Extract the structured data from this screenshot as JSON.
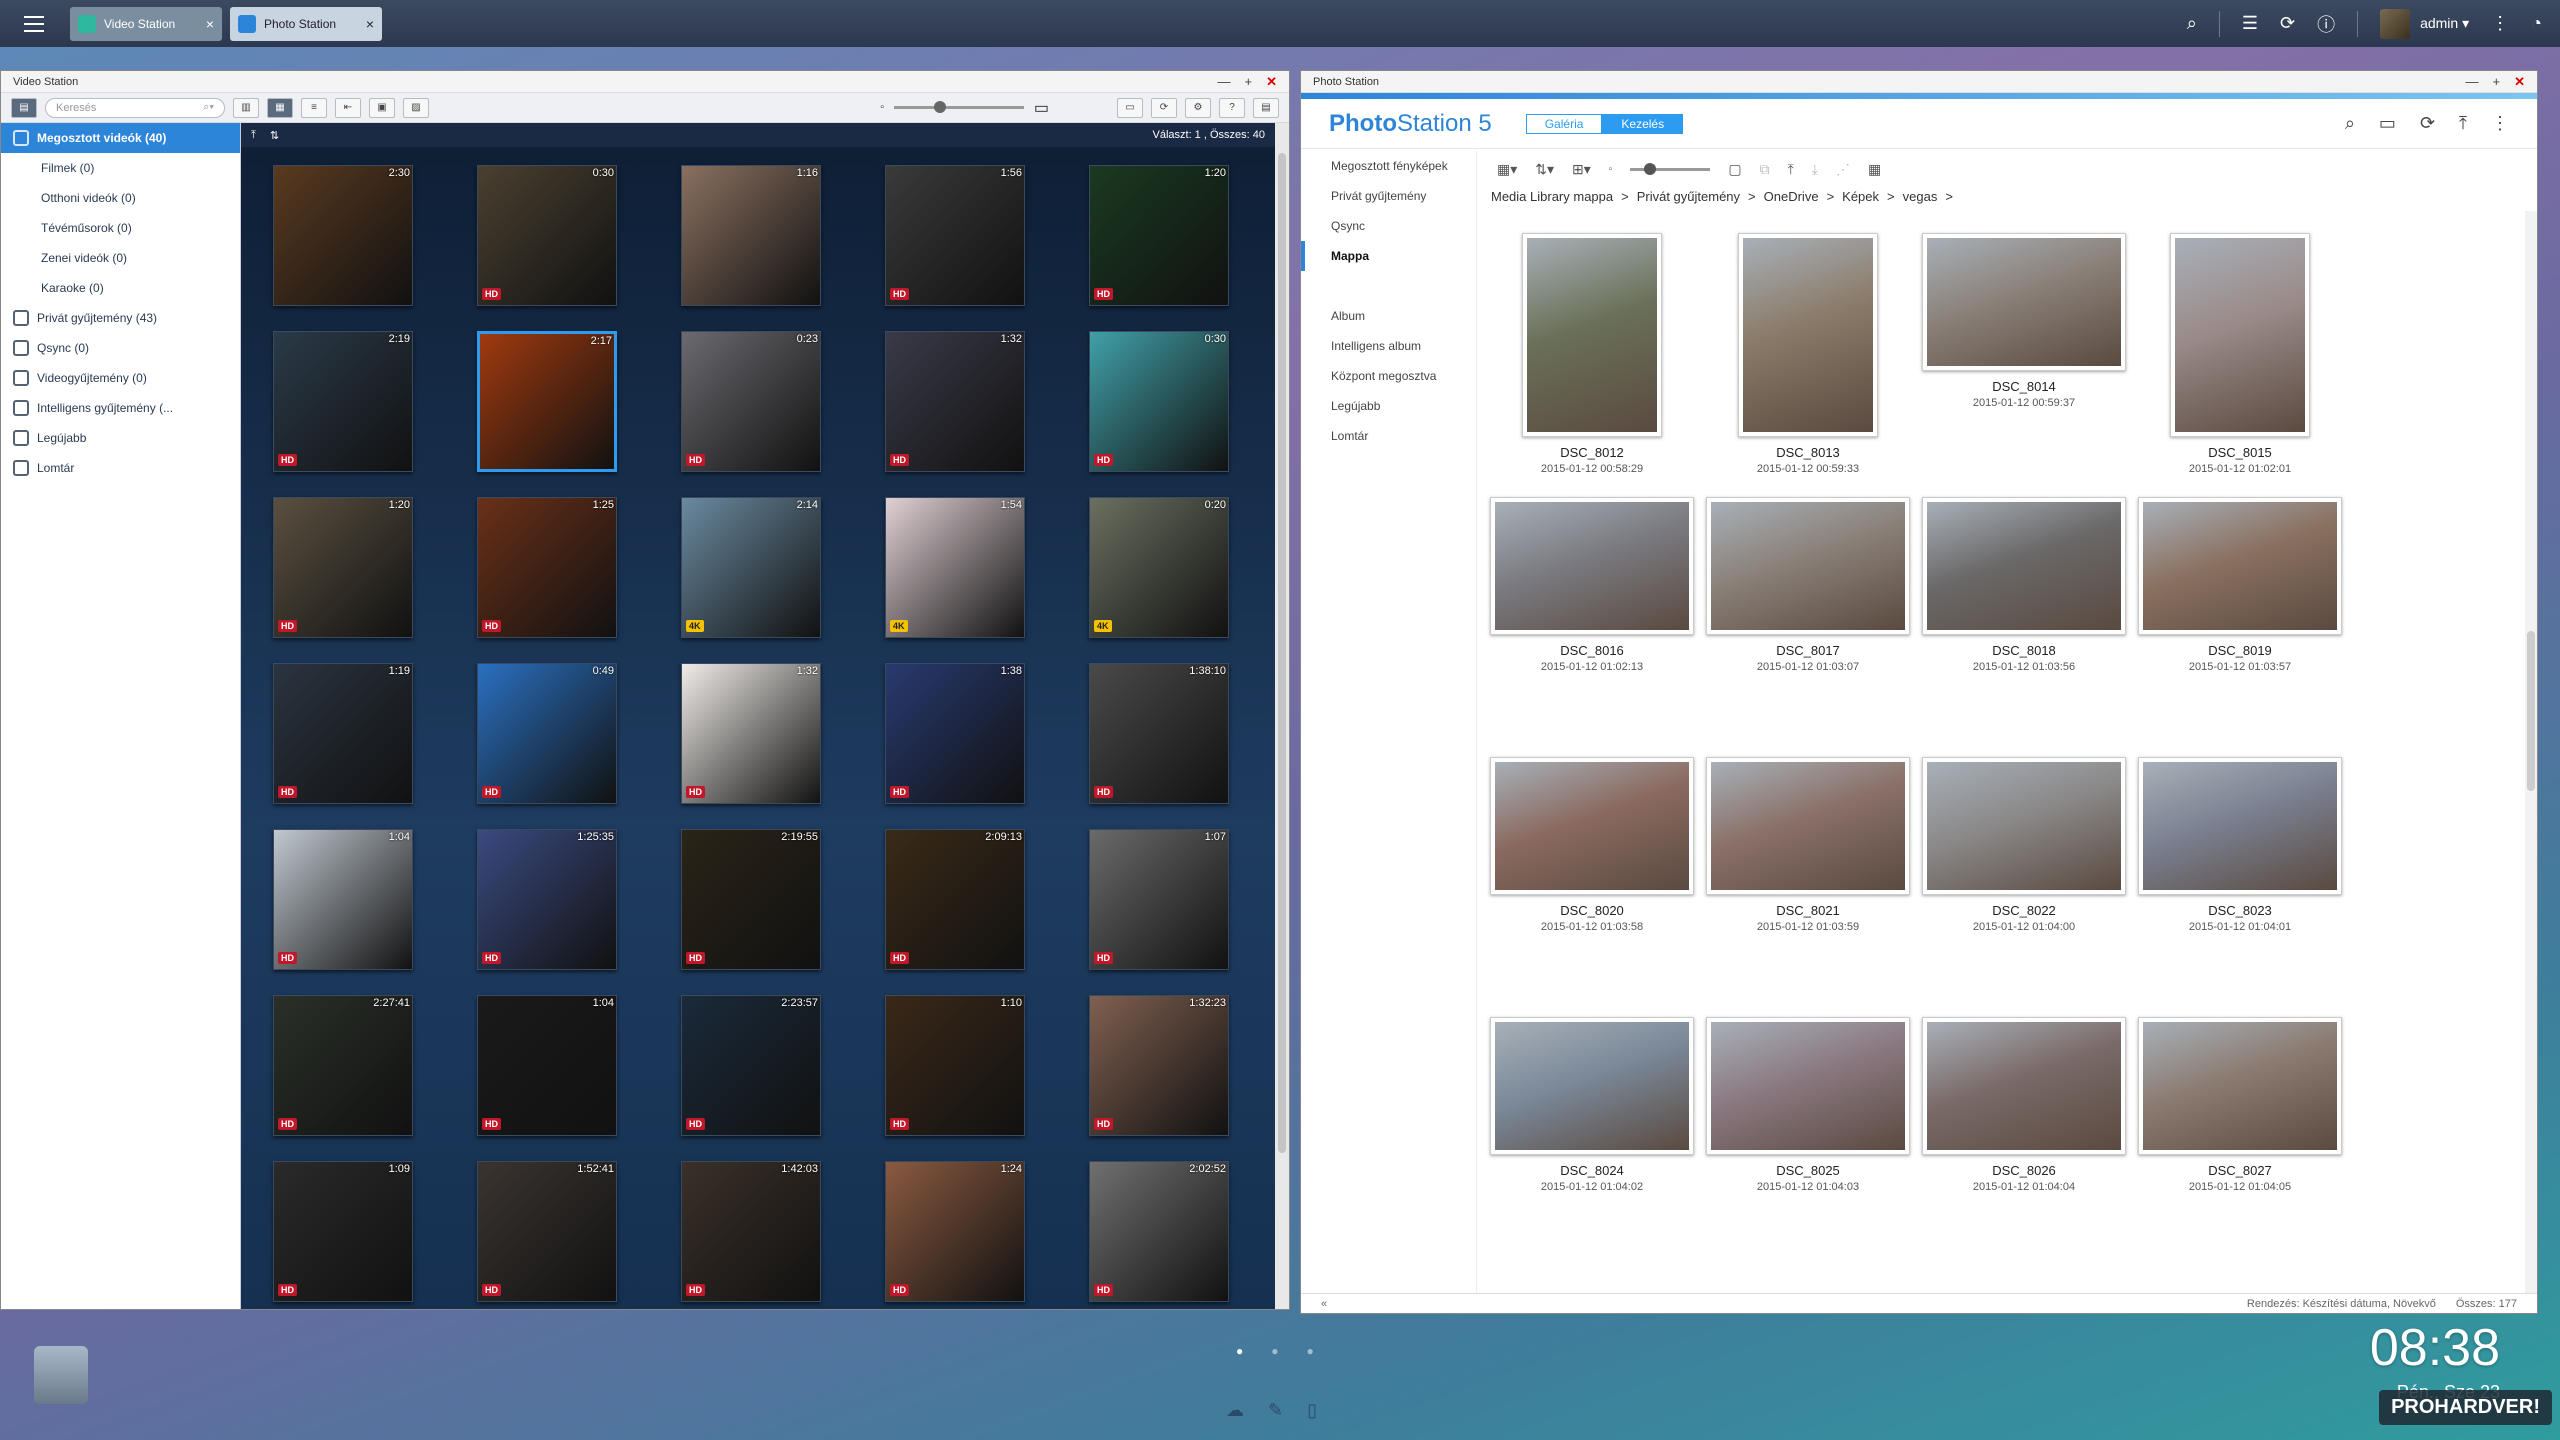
{
  "taskbar": {
    "tabs": [
      {
        "label": "Video Station"
      },
      {
        "label": "Photo Station"
      }
    ],
    "user": "admin"
  },
  "video_station": {
    "title": "Video Station",
    "search_placeholder": "Keresés",
    "selection_info": "Választ: 1 , Összes: 40",
    "sidebar": [
      {
        "label": "Megosztott videók (40)"
      },
      {
        "label": "Filmek (0)"
      },
      {
        "label": "Otthoni videók (0)"
      },
      {
        "label": "Tévéműsorok (0)"
      },
      {
        "label": "Zenei videók (0)"
      },
      {
        "label": "Karaoke (0)"
      },
      {
        "label": "Privát gyűjtemény (43)"
      },
      {
        "label": "Qsync (0)"
      },
      {
        "label": "Videogyűjtemény (0)"
      },
      {
        "label": "Intelligens gyűjtemény (..."
      },
      {
        "label": "Legújabb"
      },
      {
        "label": "Lomtár"
      }
    ],
    "videos": [
      {
        "duration": "2:30",
        "badge": "",
        "color": "#5a3a20"
      },
      {
        "duration": "0:30",
        "badge": "HD",
        "color": "#4a4030"
      },
      {
        "duration": "1:16",
        "badge": "",
        "color": "#8a7060"
      },
      {
        "duration": "1:56",
        "badge": "HD",
        "color": "#3a3a3a"
      },
      {
        "duration": "1:20",
        "badge": "HD",
        "color": "#1a3a20"
      },
      {
        "duration": "2:19",
        "badge": "HD",
        "color": "#2a3a48"
      },
      {
        "duration": "2:17",
        "badge": "",
        "color": "#a03a10"
      },
      {
        "duration": "0:23",
        "badge": "HD",
        "color": "#6a6a70"
      },
      {
        "duration": "1:32",
        "badge": "HD",
        "color": "#3a3a48"
      },
      {
        "duration": "0:30",
        "badge": "HD",
        "color": "#40a0a8"
      },
      {
        "duration": "1:20",
        "badge": "HD",
        "color": "#5a5040"
      },
      {
        "duration": "1:25",
        "badge": "HD",
        "color": "#6a3018"
      },
      {
        "duration": "2:14",
        "badge": "4K",
        "color": "#6a8aa0"
      },
      {
        "duration": "1:54",
        "badge": "4K",
        "color": "#e0d0d4"
      },
      {
        "duration": "0:20",
        "badge": "4K",
        "color": "#6a7060"
      },
      {
        "duration": "1:19",
        "badge": "HD",
        "color": "#2a3440"
      },
      {
        "duration": "0:49",
        "badge": "HD",
        "color": "#2a70c0"
      },
      {
        "duration": "1:32",
        "badge": "HD",
        "color": "#f0ece8"
      },
      {
        "duration": "1:38",
        "badge": "HD",
        "color": "#283a70"
      },
      {
        "duration": "1:38:10",
        "badge": "HD",
        "color": "#4a4a4a"
      },
      {
        "duration": "1:04",
        "badge": "HD",
        "color": "#c0c8d0"
      },
      {
        "duration": "1:25:35",
        "badge": "HD",
        "color": "#3a4a80"
      },
      {
        "duration": "2:19:55",
        "badge": "HD",
        "color": "#2a2418"
      },
      {
        "duration": "2:09:13",
        "badge": "HD",
        "color": "#3a2a18"
      },
      {
        "duration": "1:07",
        "badge": "HD",
        "color": "#6a6a6a"
      },
      {
        "duration": "2:27:41",
        "badge": "HD",
        "color": "#2a3028"
      },
      {
        "duration": "1:04",
        "badge": "HD",
        "color": "#1a1a1a"
      },
      {
        "duration": "2:23:57",
        "badge": "HD",
        "color": "#1a2a3a"
      },
      {
        "duration": "1:10",
        "badge": "HD",
        "color": "#3a2818"
      },
      {
        "duration": "1:32:23",
        "badge": "HD",
        "color": "#806050"
      },
      {
        "duration": "1:09",
        "badge": "HD",
        "color": "#2a2a2a"
      },
      {
        "duration": "1:52:41",
        "badge": "HD",
        "color": "#3a3430"
      },
      {
        "duration": "1:42:03",
        "badge": "HD",
        "color": "#3a3028"
      },
      {
        "duration": "1:24",
        "badge": "HD",
        "color": "#8a5a40"
      },
      {
        "duration": "2:02:52",
        "badge": "HD",
        "color": "#707070"
      }
    ]
  },
  "photo_station": {
    "title": "Photo Station",
    "logo_a": "Photo",
    "logo_b": "Station 5",
    "seg_galeria": "Galéria",
    "seg_kezeles": "Kezelés",
    "sidebar": [
      {
        "label": "Megosztott fényképek"
      },
      {
        "label": "Privát gyűjtemény"
      },
      {
        "label": "Qsync"
      },
      {
        "label": "Mappa"
      },
      {
        "label": "Album"
      },
      {
        "label": "Intelligens album"
      },
      {
        "label": "Központ megosztva"
      },
      {
        "label": "Legújabb"
      },
      {
        "label": "Lomtár"
      }
    ],
    "breadcrumb": [
      "Media Library mappa",
      ">",
      "Privát gyűjtemény",
      ">",
      "OneDrive",
      ">",
      "Képek",
      ">",
      "vegas",
      ">"
    ],
    "photos": [
      {
        "name": "DSC_8012",
        "date": "2015-01-12 00:58:29",
        "portrait": true,
        "color": "#6a7058"
      },
      {
        "name": "DSC_8013",
        "date": "2015-01-12 00:59:33",
        "portrait": true,
        "color": "#8a7a68"
      },
      {
        "name": "DSC_8014",
        "date": "2015-01-12 00:59:37",
        "portrait": false,
        "color": "#8a8078"
      },
      {
        "name": "DSC_8015",
        "date": "2015-01-12 01:02:01",
        "portrait": true,
        "color": "#9a8a88"
      },
      {
        "name": "DSC_8016",
        "date": "2015-01-12 01:02:13",
        "portrait": false,
        "color": "#7a7a80"
      },
      {
        "name": "DSC_8017",
        "date": "2015-01-12 01:03:07",
        "portrait": false,
        "color": "#8a8078"
      },
      {
        "name": "DSC_8018",
        "date": "2015-01-12 01:03:56",
        "portrait": false,
        "color": "#6a6868"
      },
      {
        "name": "DSC_8019",
        "date": "2015-01-12 01:03:57",
        "portrait": false,
        "color": "#8a7060"
      },
      {
        "name": "DSC_8020",
        "date": "2015-01-12 01:03:58",
        "portrait": false,
        "color": "#8a6a60"
      },
      {
        "name": "DSC_8021",
        "date": "2015-01-12 01:03:59",
        "portrait": false,
        "color": "#8a7068"
      },
      {
        "name": "DSC_8022",
        "date": "2015-01-12 01:04:00",
        "portrait": false,
        "color": "#8a8888"
      },
      {
        "name": "DSC_8023",
        "date": "2015-01-12 01:04:01",
        "portrait": false,
        "color": "#7a8090"
      },
      {
        "name": "DSC_8024",
        "date": "2015-01-12 01:04:02",
        "portrait": false,
        "color": "#7a8898"
      },
      {
        "name": "DSC_8025",
        "date": "2015-01-12 01:04:03",
        "portrait": false,
        "color": "#8a7880"
      },
      {
        "name": "DSC_8026",
        "date": "2015-01-12 01:04:04",
        "portrait": false,
        "color": "#7a6a68"
      },
      {
        "name": "DSC_8027",
        "date": "2015-01-12 01:04:05",
        "portrait": false,
        "color": "#8a7a70"
      }
    ],
    "footer_sort": "Rendezés: Készítési dátuma, Növekvő",
    "footer_total": "Összes: 177"
  },
  "desktop": {
    "clock": "08:38",
    "date_partial": "Pén., Sze 23",
    "watermark": "PROHARDVER!"
  }
}
